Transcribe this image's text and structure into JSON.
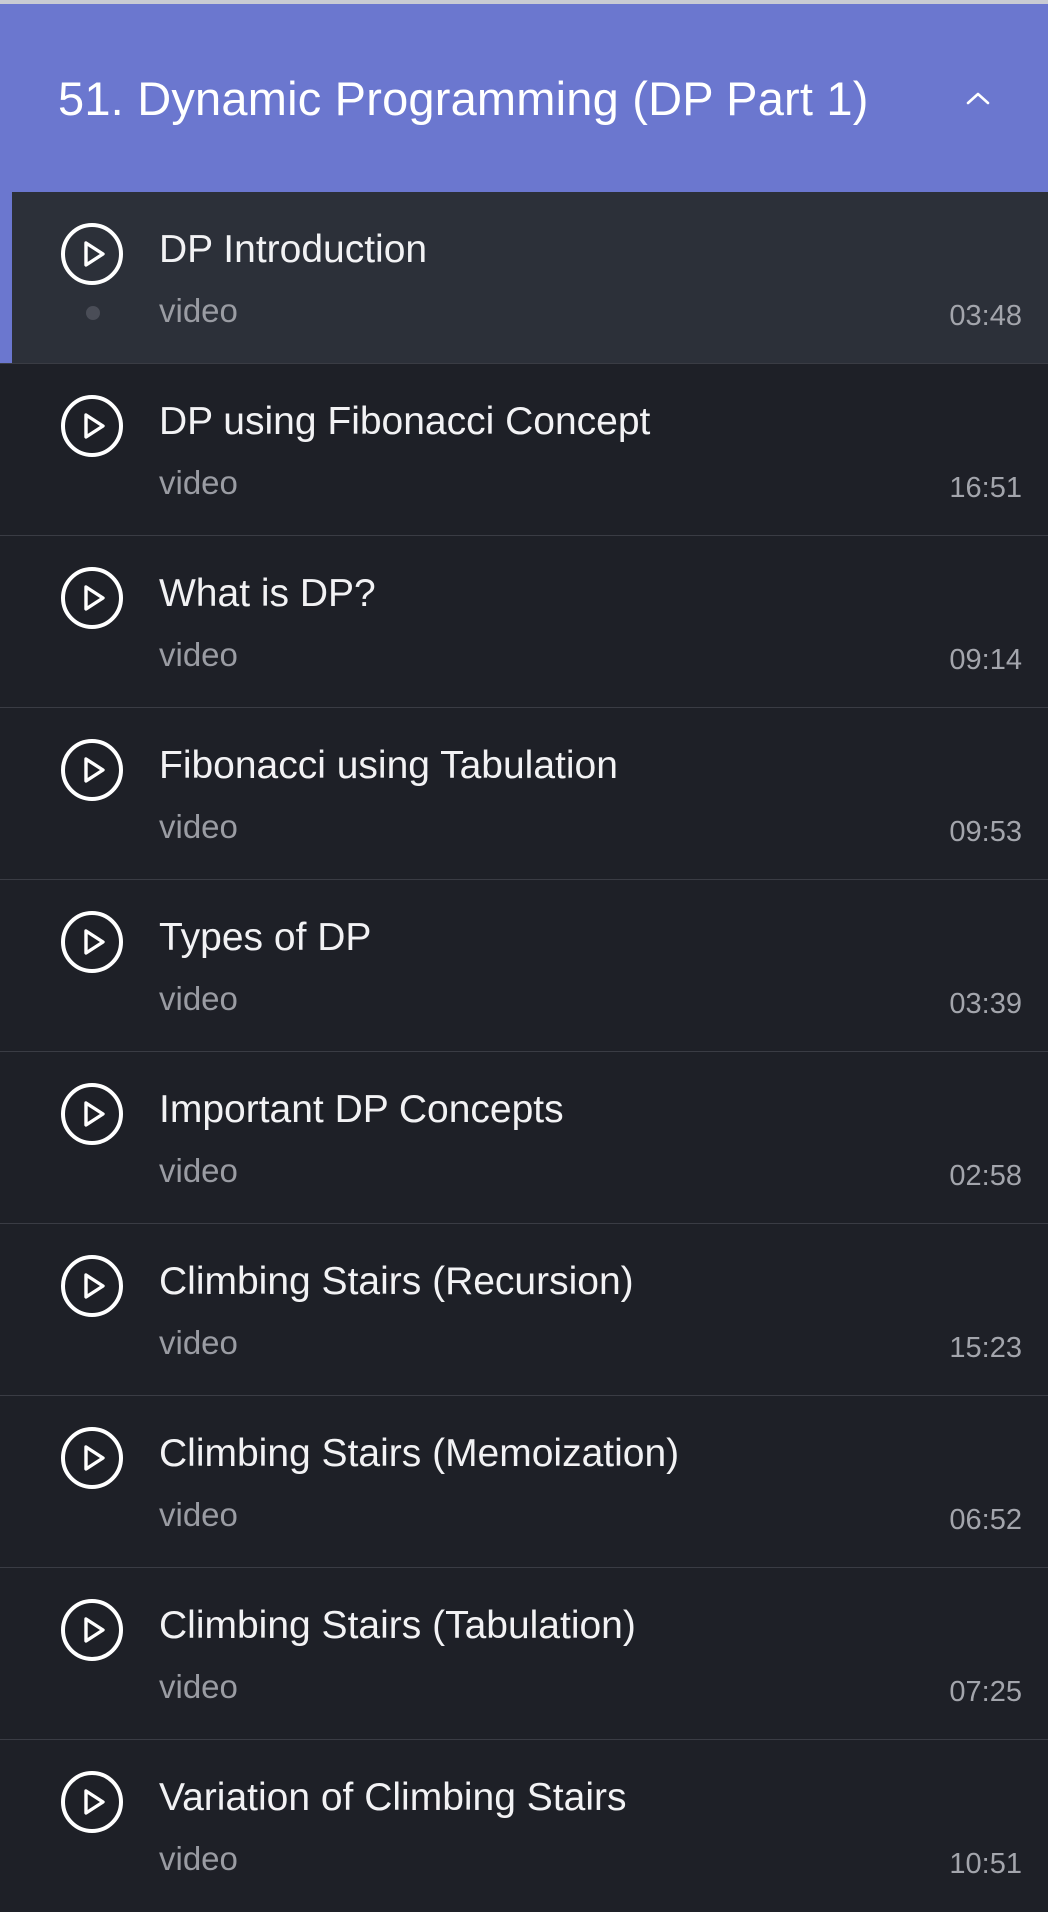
{
  "section": {
    "title": "51. Dynamic Programming (DP Part 1)",
    "collapse_icon": "chevron-up-icon",
    "accent_color": "#6b77cf"
  },
  "lessons": [
    {
      "title": "DP Introduction",
      "type": "video",
      "duration": "03:48",
      "active": true
    },
    {
      "title": "DP using Fibonacci Concept",
      "type": "video",
      "duration": "16:51"
    },
    {
      "title": "What is DP?",
      "type": "video",
      "duration": "09:14"
    },
    {
      "title": "Fibonacci using Tabulation",
      "type": "video",
      "duration": "09:53"
    },
    {
      "title": "Types of DP",
      "type": "video",
      "duration": "03:39"
    },
    {
      "title": "Important DP Concepts",
      "type": "video",
      "duration": "02:58"
    },
    {
      "title": "Climbing Stairs (Recursion)",
      "type": "video",
      "duration": "15:23"
    },
    {
      "title": "Climbing Stairs (Memoization)",
      "type": "video",
      "duration": "06:52"
    },
    {
      "title": "Climbing Stairs (Tabulation)",
      "type": "video",
      "duration": "07:25"
    },
    {
      "title": "Variation of Climbing Stairs",
      "type": "video",
      "duration": "10:51"
    }
  ]
}
